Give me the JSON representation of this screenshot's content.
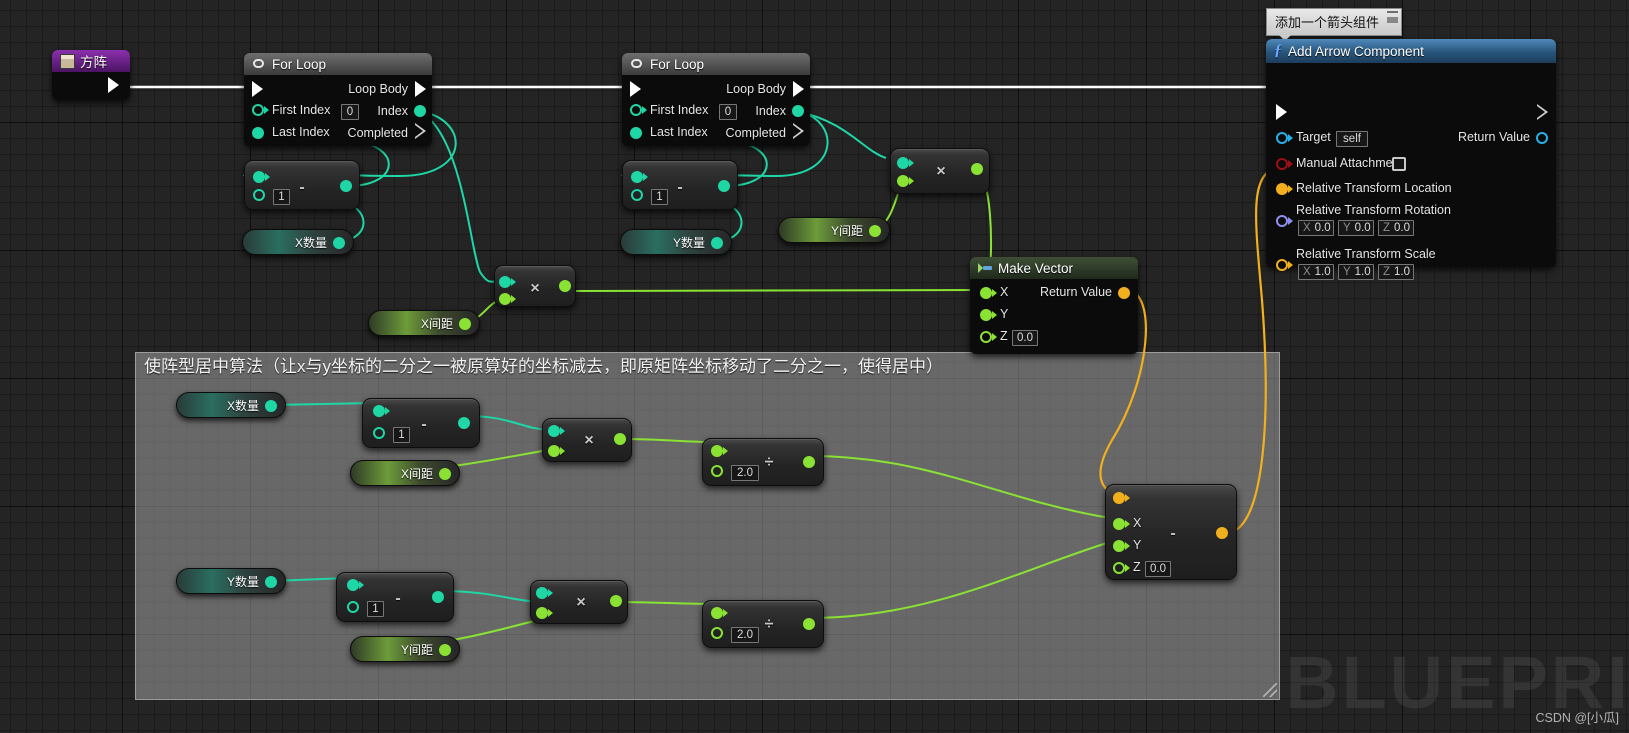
{
  "app": {
    "editor": "Unreal Engine Blueprint Graph",
    "watermark": "BLUEPRINT",
    "credit": "CSDN @[小瓜]"
  },
  "tooltip": {
    "text": "添加一个箭头组件",
    "icon": "tooltip-doc-icon"
  },
  "comment": {
    "title": "使阵型居中算法（让x与y坐标的二分之一被原算好的坐标减去，即原矩阵坐标移动了二分之一，使得居中）"
  },
  "nodes": {
    "matrix_var": {
      "title": "方阵",
      "icon": "variable-icon",
      "header_color": "#8b2fad"
    },
    "for_loop_x": {
      "title": "For Loop",
      "icon": "loop-icon",
      "inputs": [
        {
          "label": "First Index",
          "value": "0"
        },
        {
          "label": "Last Index",
          "value": ""
        }
      ],
      "outputs": [
        {
          "label": "Loop Body"
        },
        {
          "label": "Index"
        },
        {
          "label": "Completed"
        }
      ]
    },
    "for_loop_y": {
      "title": "For Loop",
      "icon": "loop-icon",
      "inputs": [
        {
          "label": "First Index",
          "value": "0"
        },
        {
          "label": "Last Index",
          "value": ""
        }
      ],
      "outputs": [
        {
          "label": "Loop Body"
        },
        {
          "label": "Index"
        },
        {
          "label": "Completed"
        }
      ]
    },
    "make_vector": {
      "title": "Make Vector",
      "icon": "make-vector-icon",
      "inputs": [
        {
          "label": "X",
          "value": ""
        },
        {
          "label": "Y",
          "value": ""
        },
        {
          "label": "Z",
          "value": "0.0"
        }
      ],
      "outputs": [
        {
          "label": "Return Value"
        }
      ]
    },
    "add_arrow": {
      "title": "Add Arrow Component",
      "icon": "function-icon",
      "inputs": [
        {
          "label": "Target",
          "value": "self"
        },
        {
          "label": "Manual Attachment",
          "value": ""
        },
        {
          "label": "Relative Transform Location",
          "value": ""
        }
      ],
      "rotation": {
        "label": "Relative Transform Rotation",
        "x": "0.0",
        "y": "0.0",
        "z": "0.0"
      },
      "scale": {
        "label": "Relative Transform Scale",
        "x": "1.0",
        "y": "1.0",
        "z": "1.0"
      },
      "outputs": [
        {
          "label": "Return Value"
        }
      ]
    },
    "sub_x_top": {
      "op": "-",
      "operand": "1"
    },
    "sub_y_top": {
      "op": "-",
      "operand": "1"
    },
    "mul_x_top": {
      "op": "×"
    },
    "mul_y_top": {
      "op": "×"
    },
    "sub_x_center": {
      "op": "-",
      "operand": "1"
    },
    "mul_x_center": {
      "op": "×"
    },
    "div_x_center": {
      "op": "÷",
      "operand": "2.0"
    },
    "sub_y_center": {
      "op": "-",
      "operand": "1"
    },
    "mul_y_center": {
      "op": "×"
    },
    "div_y_center": {
      "op": "÷",
      "operand": "2.0"
    },
    "vector_sub": {
      "op": "-",
      "inputs": [
        {
          "label": "X",
          "value": ""
        },
        {
          "label": "Y",
          "value": ""
        },
        {
          "label": "Z",
          "value": "0.0"
        }
      ]
    }
  },
  "variables": [
    {
      "id": "x_count_top",
      "label": "X数量",
      "type": "teal"
    },
    {
      "id": "x_spacing_top",
      "label": "X间距",
      "type": "green"
    },
    {
      "id": "y_count_top",
      "label": "Y数量",
      "type": "teal"
    },
    {
      "id": "y_spacing_top",
      "label": "Y间距",
      "type": "green"
    },
    {
      "id": "x_count_center",
      "label": "X数量",
      "type": "teal"
    },
    {
      "id": "x_spacing_center",
      "label": "X间距",
      "type": "green"
    },
    {
      "id": "y_count_center",
      "label": "Y数量",
      "type": "teal"
    },
    {
      "id": "y_spacing_center",
      "label": "Y间距",
      "type": "green"
    }
  ],
  "colors": {
    "exec_wire": "#ffffff",
    "int_pin": "#1fd6a5",
    "float_pin": "#8ae234",
    "vector_pin": "#f2b01e",
    "object_pin": "#25b0e8",
    "bool_pin": "#9c0f16",
    "rotator_pin": "#8f8ff0",
    "comment_fill": "#a0a0a0",
    "node_body": "#0b0b0b"
  }
}
